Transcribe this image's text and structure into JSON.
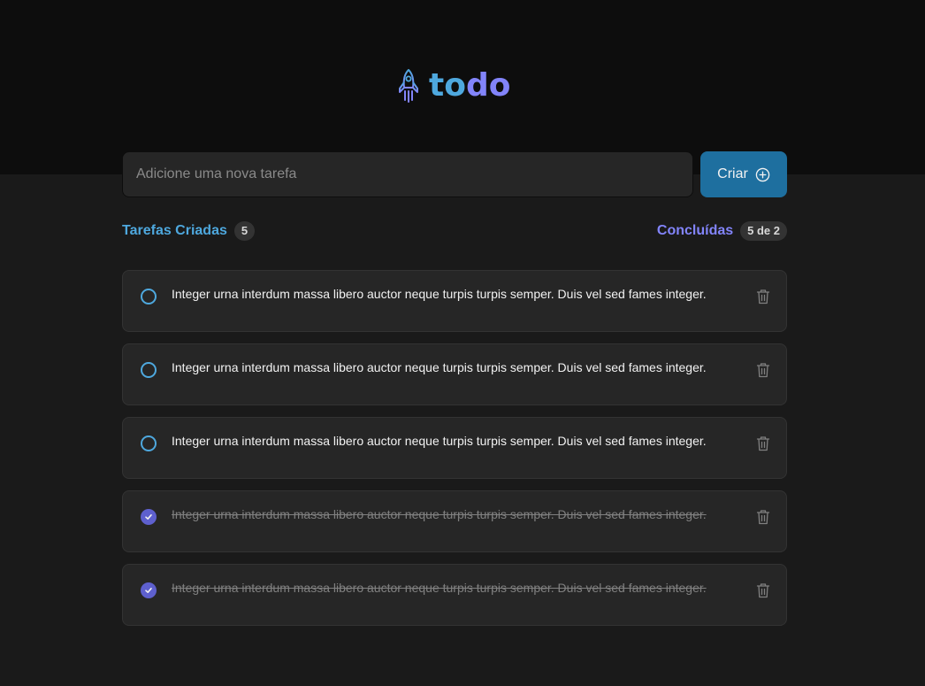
{
  "brand": {
    "name_part1": "to",
    "name_part2": "do",
    "icon": "rocket-icon",
    "color1": "#4ea8de",
    "color2": "#8284fa"
  },
  "new_task": {
    "placeholder": "Adicione uma nova tarefa",
    "value": "",
    "button_label": "Criar",
    "button_icon": "plus-circle-icon"
  },
  "stats": {
    "created_label": "Tarefas Criadas",
    "created_count": "5",
    "done_label": "Concluídas",
    "done_count": "5 de 2"
  },
  "tasks": [
    {
      "text": "Integer urna interdum massa libero auctor neque turpis turpis semper. Duis vel sed fames integer.",
      "done": false
    },
    {
      "text": "Integer urna interdum massa libero auctor neque turpis turpis semper. Duis vel sed fames integer.",
      "done": false
    },
    {
      "text": "Integer urna interdum massa libero auctor neque turpis turpis semper. Duis vel sed fames integer.",
      "done": false
    },
    {
      "text": "Integer urna interdum massa libero auctor neque turpis turpis semper. Duis vel sed fames integer.",
      "done": true
    },
    {
      "text": "Integer urna interdum massa libero auctor neque turpis turpis semper. Duis vel sed fames integer.",
      "done": true
    }
  ]
}
